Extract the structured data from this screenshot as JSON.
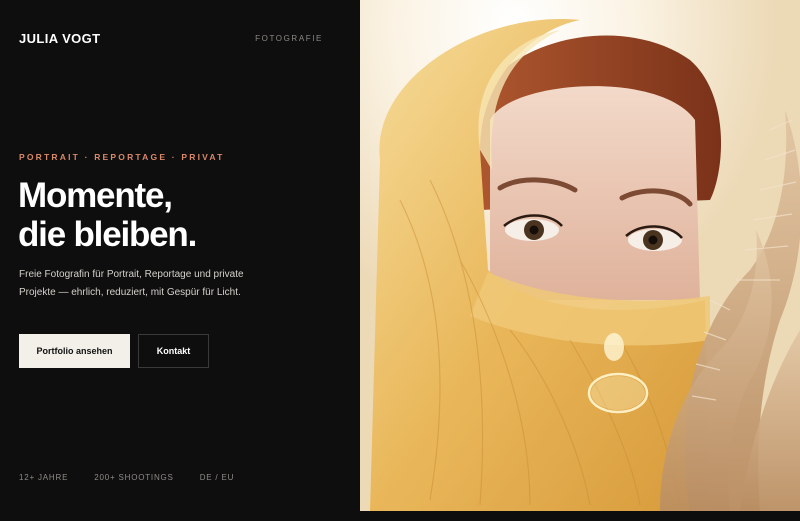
{
  "brand": {
    "name": "JULIA VOGT"
  },
  "nav": {
    "link": "FOTOGRAFIE"
  },
  "hero": {
    "eyebrow": "PORTRAIT · REPORTAGE · PRIVAT",
    "headline_line1": "Momente,",
    "headline_line2": "die bleiben.",
    "lede": "Freie Fotografin für Portrait, Reportage und private Projekte — ehrlich, reduziert, mit Gespür für Licht.",
    "cta_primary": "Portfolio ansehen",
    "cta_secondary": "Kontakt"
  },
  "stats": [
    "12+ JAHRE",
    "200+ SHOOTINGS",
    "DE / EU"
  ],
  "colors": {
    "accent": "#d9886a",
    "background": "#0e0e0e",
    "button_light": "#f3f0e9"
  }
}
